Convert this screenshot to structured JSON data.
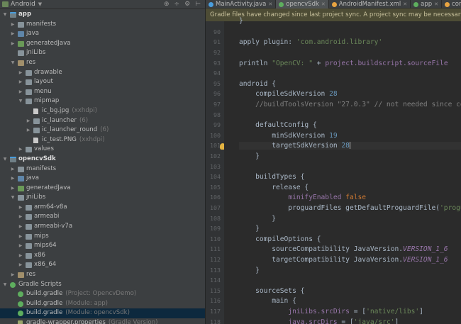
{
  "project_panel": {
    "view_selector": "Android",
    "rows": [
      {
        "indent": 0,
        "arrow": "open",
        "icon": "module",
        "label": "app",
        "bold": true,
        "hint": ""
      },
      {
        "indent": 1,
        "arrow": "closed",
        "icon": "folder",
        "label": "manifests",
        "hint": ""
      },
      {
        "indent": 1,
        "arrow": "closed",
        "icon": "folder-src",
        "label": "java",
        "hint": ""
      },
      {
        "indent": 1,
        "arrow": "closed",
        "icon": "folder-gen",
        "label": "generatedJava",
        "hint": ""
      },
      {
        "indent": 1,
        "arrow": "none",
        "icon": "folder",
        "label": "jniLibs",
        "hint": ""
      },
      {
        "indent": 1,
        "arrow": "open",
        "icon": "folder-res",
        "label": "res",
        "hint": ""
      },
      {
        "indent": 2,
        "arrow": "closed",
        "icon": "folder",
        "label": "drawable",
        "hint": ""
      },
      {
        "indent": 2,
        "arrow": "closed",
        "icon": "folder",
        "label": "layout",
        "hint": ""
      },
      {
        "indent": 2,
        "arrow": "closed",
        "icon": "folder",
        "label": "menu",
        "hint": ""
      },
      {
        "indent": 2,
        "arrow": "open",
        "icon": "folder",
        "label": "mipmap",
        "hint": ""
      },
      {
        "indent": 3,
        "arrow": "none",
        "icon": "file",
        "label": "ic_bg.jpg",
        "hint": "(xxhdpi)"
      },
      {
        "indent": 3,
        "arrow": "closed",
        "icon": "folder",
        "label": "ic_launcher",
        "hint": "(6)"
      },
      {
        "indent": 3,
        "arrow": "closed",
        "icon": "folder",
        "label": "ic_launcher_round",
        "hint": "(6)"
      },
      {
        "indent": 3,
        "arrow": "none",
        "icon": "file",
        "label": "ic_test.PNG",
        "hint": "(xxhdpi)"
      },
      {
        "indent": 2,
        "arrow": "closed",
        "icon": "folder",
        "label": "values",
        "hint": ""
      },
      {
        "indent": 0,
        "arrow": "open",
        "icon": "module",
        "label": "opencvSdk",
        "bold": true,
        "hint": ""
      },
      {
        "indent": 1,
        "arrow": "closed",
        "icon": "folder",
        "label": "manifests",
        "hint": ""
      },
      {
        "indent": 1,
        "arrow": "closed",
        "icon": "folder-src",
        "label": "java",
        "hint": ""
      },
      {
        "indent": 1,
        "arrow": "closed",
        "icon": "folder-gen",
        "label": "generatedJava",
        "hint": ""
      },
      {
        "indent": 1,
        "arrow": "open",
        "icon": "folder",
        "label": "jniLibs",
        "hint": ""
      },
      {
        "indent": 2,
        "arrow": "closed",
        "icon": "folder",
        "label": "arm64-v8a",
        "hint": ""
      },
      {
        "indent": 2,
        "arrow": "closed",
        "icon": "folder",
        "label": "armeabi",
        "hint": ""
      },
      {
        "indent": 2,
        "arrow": "closed",
        "icon": "folder",
        "label": "armeabi-v7a",
        "hint": ""
      },
      {
        "indent": 2,
        "arrow": "closed",
        "icon": "folder",
        "label": "mips",
        "hint": ""
      },
      {
        "indent": 2,
        "arrow": "closed",
        "icon": "folder",
        "label": "mips64",
        "hint": ""
      },
      {
        "indent": 2,
        "arrow": "closed",
        "icon": "folder",
        "label": "x86",
        "hint": ""
      },
      {
        "indent": 2,
        "arrow": "closed",
        "icon": "folder",
        "label": "x86_64",
        "hint": ""
      },
      {
        "indent": 1,
        "arrow": "closed",
        "icon": "folder-res",
        "label": "res",
        "hint": ""
      },
      {
        "indent": 0,
        "arrow": "open",
        "icon": "gradle",
        "label": "Gradle Scripts",
        "hint": ""
      },
      {
        "indent": 1,
        "arrow": "none",
        "icon": "gradle",
        "label": "build.gradle",
        "hint": "(Project: OpencvDemo)"
      },
      {
        "indent": 1,
        "arrow": "none",
        "icon": "gradle",
        "label": "build.gradle",
        "hint": "(Module: app)"
      },
      {
        "indent": 1,
        "arrow": "none",
        "icon": "gradle",
        "label": "build.gradle",
        "hint": "(Module: opencvSdk)",
        "selected": true
      },
      {
        "indent": 1,
        "arrow": "none",
        "icon": "props",
        "label": "gradle-wrapper.properties",
        "hint": "(Gradle Version)"
      }
    ]
  },
  "tabs": [
    {
      "label": "MainActivity.java",
      "icon_color": "#4a9ede",
      "active": false
    },
    {
      "label": "opencvSdk",
      "icon_color": "#5eae5e",
      "active": true
    },
    {
      "label": "AndroidManifest.xml",
      "icon_color": "#e8a441",
      "active": false
    },
    {
      "label": "app",
      "icon_color": "#5eae5e",
      "active": false
    },
    {
      "label": "conte",
      "icon_color": "#e8a441",
      "active": false
    }
  ],
  "notification": "Gradle files have changed since last project sync. A project sync may be necessary for the IDE",
  "editor": {
    "line_numbers": [
      "90",
      "91",
      "92",
      "93",
      "94",
      "95",
      "96",
      "97",
      "98",
      "99",
      "100",
      "101",
      "102",
      "103",
      "104",
      "105",
      "106",
      "107",
      "108",
      "109",
      "110",
      "111",
      "112",
      "113",
      "114",
      "115",
      "116",
      "117",
      "118"
    ],
    "current_line": "101",
    "bulb_line": "101"
  }
}
